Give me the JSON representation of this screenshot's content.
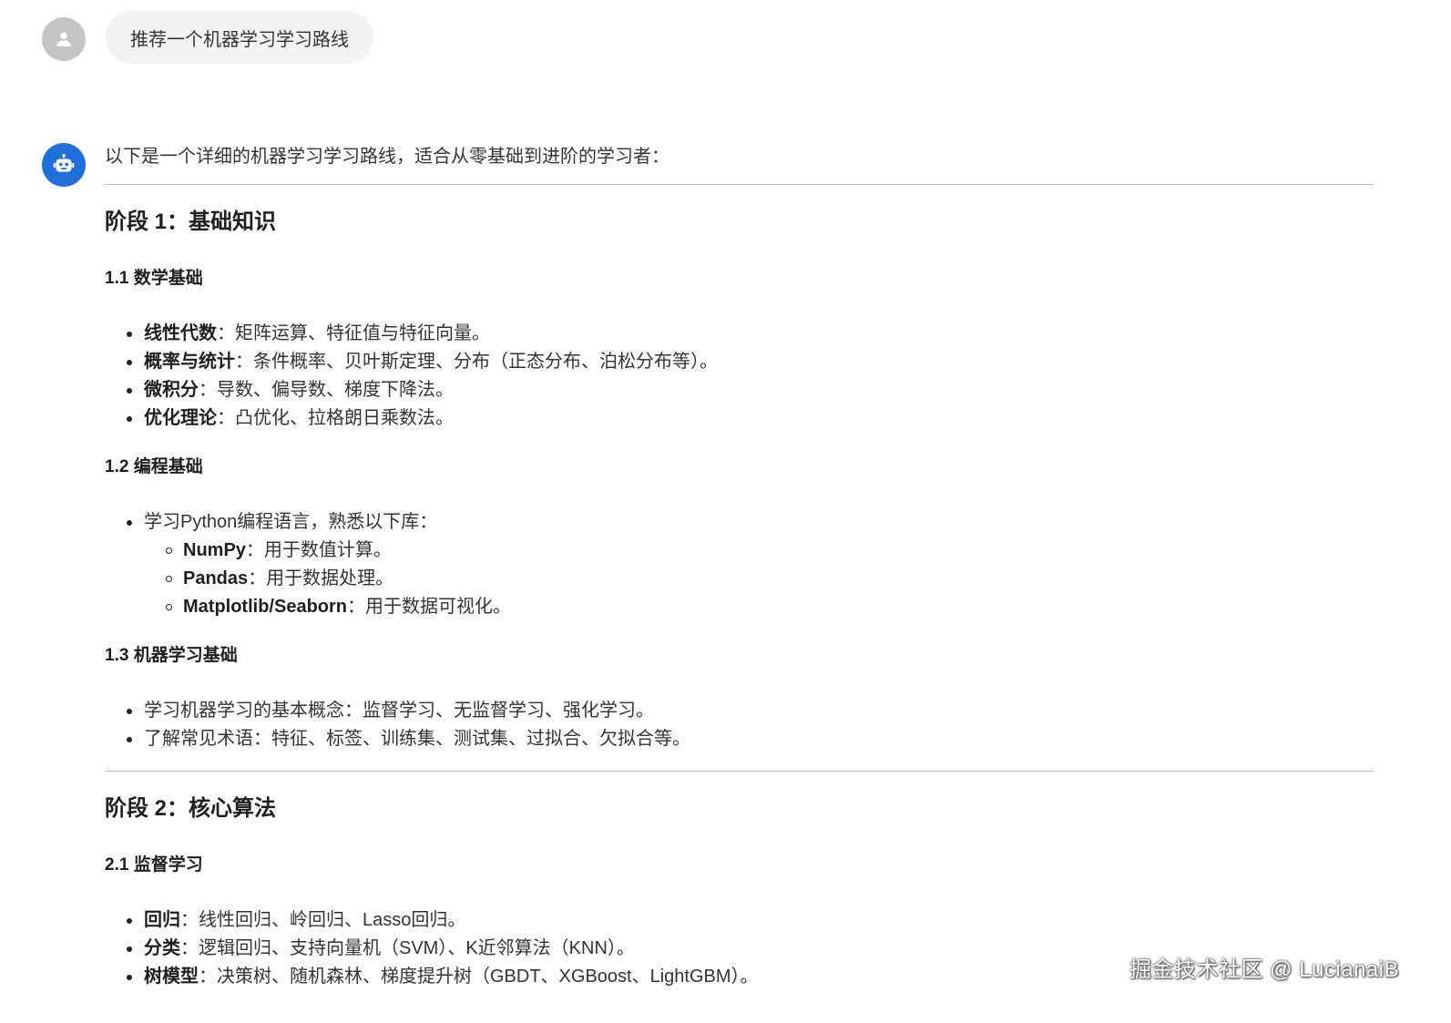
{
  "user_message": {
    "text": "推荐一个机器学习学习路线"
  },
  "assistant_message": {
    "intro": "以下是一个详细的机器学习学习路线，适合从零基础到进阶的学习者：",
    "stage1": {
      "title": "阶段 1：基础知识",
      "sections": [
        {
          "title": "1.1 数学基础",
          "items": [
            {
              "term": "线性代数",
              "sep": "：",
              "text": "矩阵运算、特征值与特征向量。"
            },
            {
              "term": "概率与统计",
              "sep": "：",
              "text": "条件概率、贝叶斯定理、分布（正态分布、泊松分布等）。"
            },
            {
              "term": "微积分",
              "sep": "：",
              "text": "导数、偏导数、梯度下降法。"
            },
            {
              "term": "优化理论",
              "sep": "：",
              "text": "凸优化、拉格朗日乘数法。"
            }
          ]
        },
        {
          "title": "1.2 编程基础",
          "items": [
            {
              "text": "学习Python编程语言，熟悉以下库：",
              "subitems": [
                {
                  "term": "NumPy",
                  "sep": "：",
                  "text": "用于数值计算。"
                },
                {
                  "term": "Pandas",
                  "sep": "：",
                  "text": "用于数据处理。"
                },
                {
                  "term": "Matplotlib/Seaborn",
                  "sep": "：",
                  "text": "用于数据可视化。"
                }
              ]
            }
          ]
        },
        {
          "title": "1.3 机器学习基础",
          "items": [
            {
              "text": "学习机器学习的基本概念：监督学习、无监督学习、强化学习。"
            },
            {
              "text": "了解常见术语：特征、标签、训练集、测试集、过拟合、欠拟合等。"
            }
          ]
        }
      ]
    },
    "stage2": {
      "title": "阶段 2：核心算法",
      "sections": [
        {
          "title": "2.1 监督学习",
          "items": [
            {
              "term": "回归",
              "sep": "：",
              "text": "线性回归、岭回归、Lasso回归。"
            },
            {
              "term": "分类",
              "sep": "：",
              "text": "逻辑回归、支持向量机（SVM）、K近邻算法（KNN）。"
            },
            {
              "term": "树模型",
              "sep": "：",
              "text": "决策树、随机森林、梯度提升树（GBDT、XGBoost、LightGBM）。"
            }
          ]
        }
      ]
    }
  },
  "watermark": {
    "text": "掘金技术社区 @ LucianaiB"
  },
  "colors": {
    "bot_avatar": "#1e6fd9",
    "user_avatar": "#c4c4c4",
    "bubble_bg": "#f3f3f3",
    "rule": "#bdbdbd"
  },
  "icons": {
    "user_avatar": "person-icon",
    "bot_avatar": "robot-icon"
  }
}
